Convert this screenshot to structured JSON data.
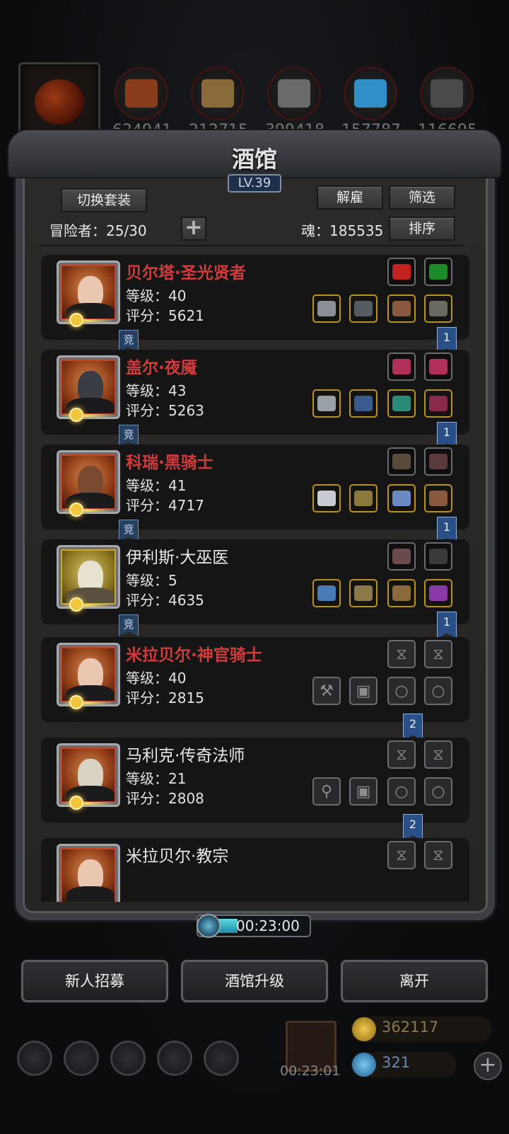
{
  "resources": [
    {
      "name": "pumpkin-portrait"
    },
    {
      "name": "meat",
      "value": "624941",
      "color": "#8a3d1c"
    },
    {
      "name": "wood",
      "value": "212715",
      "color": "#8b6a3a"
    },
    {
      "name": "stone",
      "value": "399418",
      "color": "#6a6a6a"
    },
    {
      "name": "crystal",
      "value": "157787",
      "color": "#2f8fc6"
    },
    {
      "name": "iron",
      "value": "116695",
      "color": "#4a4a4a"
    }
  ],
  "panel": {
    "title": "酒馆",
    "level": "LV.39",
    "switch_outfit": "切换套装",
    "adventurers_label": "冒险者：25/30",
    "plus": "+",
    "dismiss": "解雇",
    "filter": "筛选",
    "soul_label": "魂：185535",
    "sort": "排序"
  },
  "heroes": [
    {
      "name": "贝尔塔·圣光贤者",
      "color": "red",
      "level": "等级：40",
      "score": "评分：5621",
      "comp": "竞",
      "rank": "1",
      "face": "#e9c7b0",
      "gold": false
    },
    {
      "name": "盖尔·夜魇",
      "color": "red",
      "level": "等级：43",
      "score": "评分：5263",
      "comp": "竞",
      "rank": "1",
      "face": "#3a3d44",
      "gold": false
    },
    {
      "name": "科瑞·黑骑士",
      "color": "red",
      "level": "等级：41",
      "score": "评分：4717",
      "comp": "竞",
      "rank": "1",
      "face": "#7a4a30",
      "gold": false
    },
    {
      "name": "伊利斯·大巫医",
      "color": "white",
      "level": "等级：5",
      "score": "评分：4635",
      "comp": "竞",
      "rank": "1",
      "face": "#e7e1cf",
      "gold": true
    },
    {
      "name": "米拉贝尔·神官骑士",
      "color": "red",
      "level": "等级：40",
      "score": "评分：2815",
      "comp": "",
      "rank": "2",
      "face": "#e9c7b0",
      "gold": false
    },
    {
      "name": "马利克·传奇法师",
      "color": "white",
      "level": "等级：21",
      "score": "评分：2808",
      "comp": "",
      "rank": "2",
      "face": "#d9d3c4",
      "gold": false
    },
    {
      "name": "米拉贝尔·教宗",
      "color": "white",
      "level": "",
      "score": "",
      "comp": "",
      "rank": "",
      "face": "#e9c7b0",
      "gold": false
    }
  ],
  "timer": "00:23:00",
  "buttons": {
    "recruit": "新人招募",
    "upgrade": "酒馆升级",
    "leave": "离开"
  },
  "hud": {
    "gift_time": "00:23:01",
    "gold": "362117",
    "gems": "321"
  }
}
